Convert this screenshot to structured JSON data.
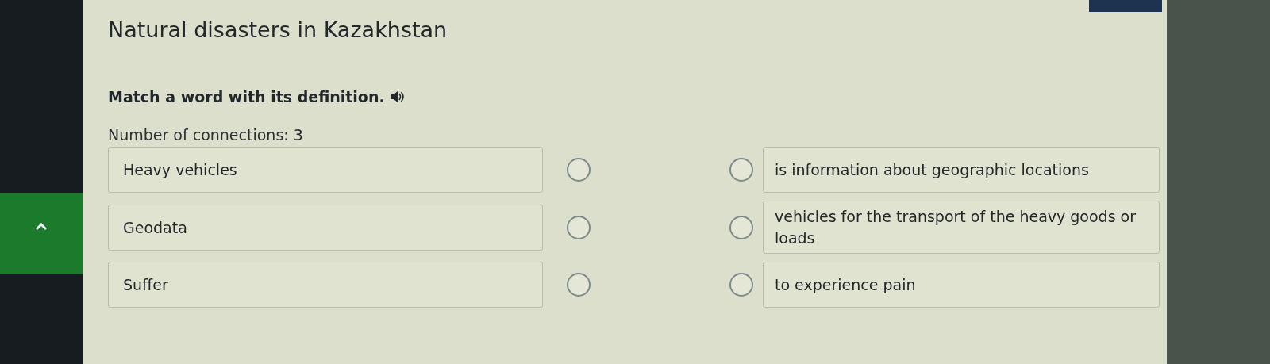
{
  "title": "Natural disasters in Kazakhstan",
  "instruction": "Match a word with its definition.",
  "connections_label": "Number of connections: 3",
  "pairs": [
    {
      "word": "Heavy vehicles",
      "word_selected": false,
      "definition": "is information about geographic locations",
      "definition_selected": false
    },
    {
      "word": "Geodata",
      "word_selected": false,
      "definition": "vehicles for the transport of the heavy goods or loads",
      "definition_selected": false
    },
    {
      "word": "Suffer",
      "word_selected": false,
      "definition": "to experience pain",
      "definition_selected": false
    }
  ]
}
